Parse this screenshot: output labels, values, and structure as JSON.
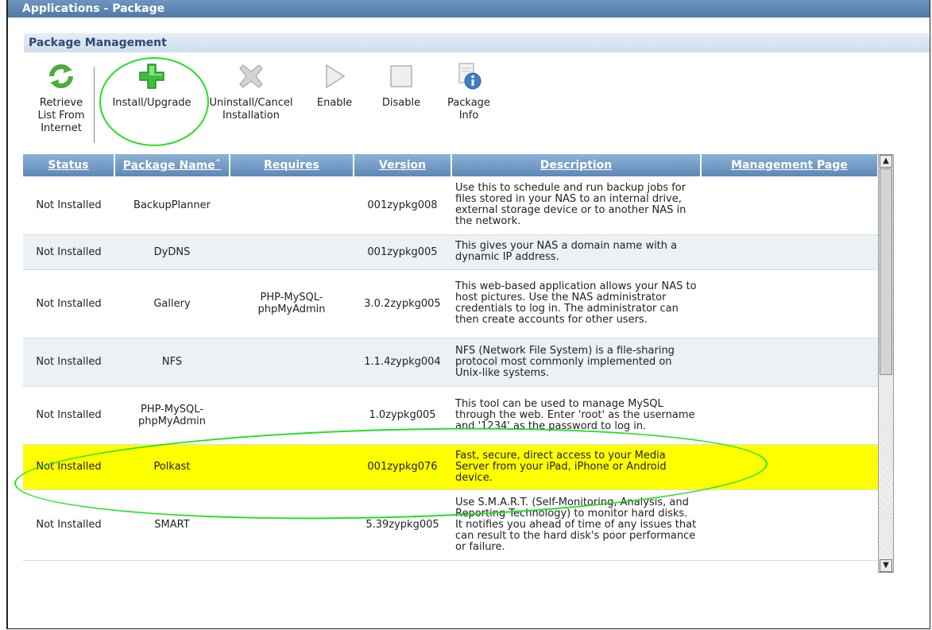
{
  "window": {
    "title": "Applications - Package"
  },
  "section": {
    "title": "Package Management"
  },
  "toolbar": {
    "retrieve_label": "Retrieve List From Internet",
    "install_label": "Install/Upgrade",
    "uninstall_label": "Uninstall/Cancel Installation",
    "enable_label": "Enable",
    "disable_label": "Disable",
    "info_label": "Package Info"
  },
  "table": {
    "headers": {
      "status": "Status",
      "name": "Package Name",
      "requires": "Requires",
      "version": "Version",
      "description": "Description",
      "management": "Management Page"
    },
    "sort_indicator": "^",
    "rows": [
      {
        "status": "Not Installed",
        "name": "BackupPlanner",
        "requires": "",
        "version": "001zypkg008",
        "description": "Use this to schedule and run backup jobs for files stored in your NAS to an internal drive, external storage device or to another NAS in the network.",
        "management": ""
      },
      {
        "status": "Not Installed",
        "name": "DyDNS",
        "requires": "",
        "version": "001zypkg005",
        "description": "This gives your NAS a domain name with a dynamic IP address.",
        "management": ""
      },
      {
        "status": "Not Installed",
        "name": "Gallery",
        "requires": "PHP-MySQL-phpMyAdmin",
        "version": "3.0.2zypkg005",
        "description": "This web-based application allows your NAS to host pictures. Use the NAS administrator credentials to log in. The administrator can then create accounts for other users.",
        "management": ""
      },
      {
        "status": "Not Installed",
        "name": "NFS",
        "requires": "",
        "version": "1.1.4zypkg004",
        "description": "NFS (Network File System) is a file-sharing protocol most commonly implemented on Unix-like systems.",
        "management": ""
      },
      {
        "status": "Not Installed",
        "name": "PHP-MySQL-phpMyAdmin",
        "requires": "",
        "version": "1.0zypkg005",
        "description": "This tool can be used to manage MySQL through the web. Enter 'root' as the username and '1234' as the password to log in.",
        "management": ""
      },
      {
        "status": "Not Installed",
        "name": "Polkast",
        "requires": "",
        "version": "001zypkg076",
        "description": "Fast, secure, direct access to your Media Server from your iPad, iPhone or Android device.",
        "management": ""
      },
      {
        "status": "Not Installed",
        "name": "SMART",
        "requires": "",
        "version": "5.39zypkg005",
        "description": "Use S.M.A.R.T. (Self-Monitoring, Analysis, and Reporting Technology) to monitor hard disks. It notifies you ahead of time of any issues that can result to the hard disk's poor performance or failure.",
        "management": ""
      }
    ]
  },
  "colors": {
    "highlight_row": "#ffff00",
    "annotation": "#22e022",
    "header": "#5d88b6"
  },
  "icons": [
    "refresh-icon",
    "plus-icon",
    "x-icon",
    "play-icon",
    "stop-icon",
    "info-icon",
    "scroll-up-icon",
    "scroll-down-icon"
  ]
}
